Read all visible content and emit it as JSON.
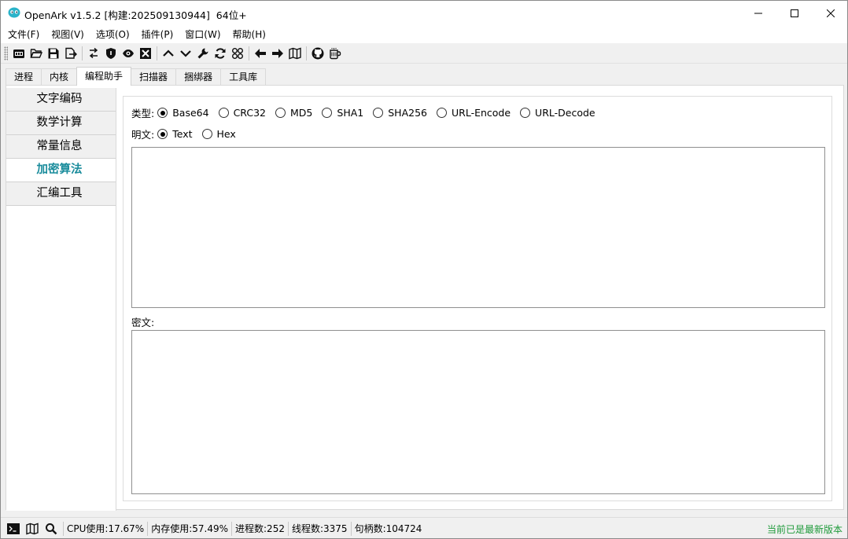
{
  "window": {
    "title": "OpenArk v1.5.2 [构建:202509130944]  64位+",
    "minimize_icon": "minimize-icon",
    "maximize_icon": "maximize-icon",
    "close_icon": "close-icon"
  },
  "menu": {
    "items": [
      "文件(F)",
      "视图(V)",
      "选项(O)",
      "插件(P)",
      "窗口(W)",
      "帮助(H)"
    ]
  },
  "toolbar": {
    "icons": [
      "console-icon",
      "folder-open-icon",
      "save-icon",
      "export-icon",
      "switch-icon",
      "shield-icon",
      "eye-icon",
      "close-box-icon",
      "chevron-up-icon",
      "chevron-down-icon",
      "wrench-icon",
      "refresh-icon",
      "grid-icon",
      "arrow-left-icon",
      "arrow-right-icon",
      "map-icon",
      "github-icon",
      "mug-icon"
    ]
  },
  "tabs": {
    "items": [
      "进程",
      "内核",
      "编程助手",
      "扫描器",
      "捆绑器",
      "工具库"
    ],
    "active": "编程助手"
  },
  "sidebar": {
    "items": [
      "文字编码",
      "数学计算",
      "常量信息",
      "加密算法",
      "汇编工具"
    ],
    "active": "加密算法"
  },
  "crypto": {
    "type_label": "类型:",
    "types": [
      "Base64",
      "CRC32",
      "MD5",
      "SHA1",
      "SHA256",
      "URL-Encode",
      "URL-Decode"
    ],
    "selected_type": "Base64",
    "plain_label": "明文:",
    "plain_modes": [
      "Text",
      "Hex"
    ],
    "selected_plain_mode": "Text",
    "plaintext_value": "",
    "cipher_label": "密文:",
    "ciphertext_value": ""
  },
  "statusbar": {
    "cpu": "CPU使用:17.67%",
    "memory": "内存使用:57.49%",
    "processes": "进程数:252",
    "threads": "线程数:3375",
    "handles": "句柄数:104724",
    "version_status": "当前已是最新版本"
  },
  "colors": {
    "accent_teal": "#1a8c9c",
    "status_green": "#1e9a3a"
  }
}
